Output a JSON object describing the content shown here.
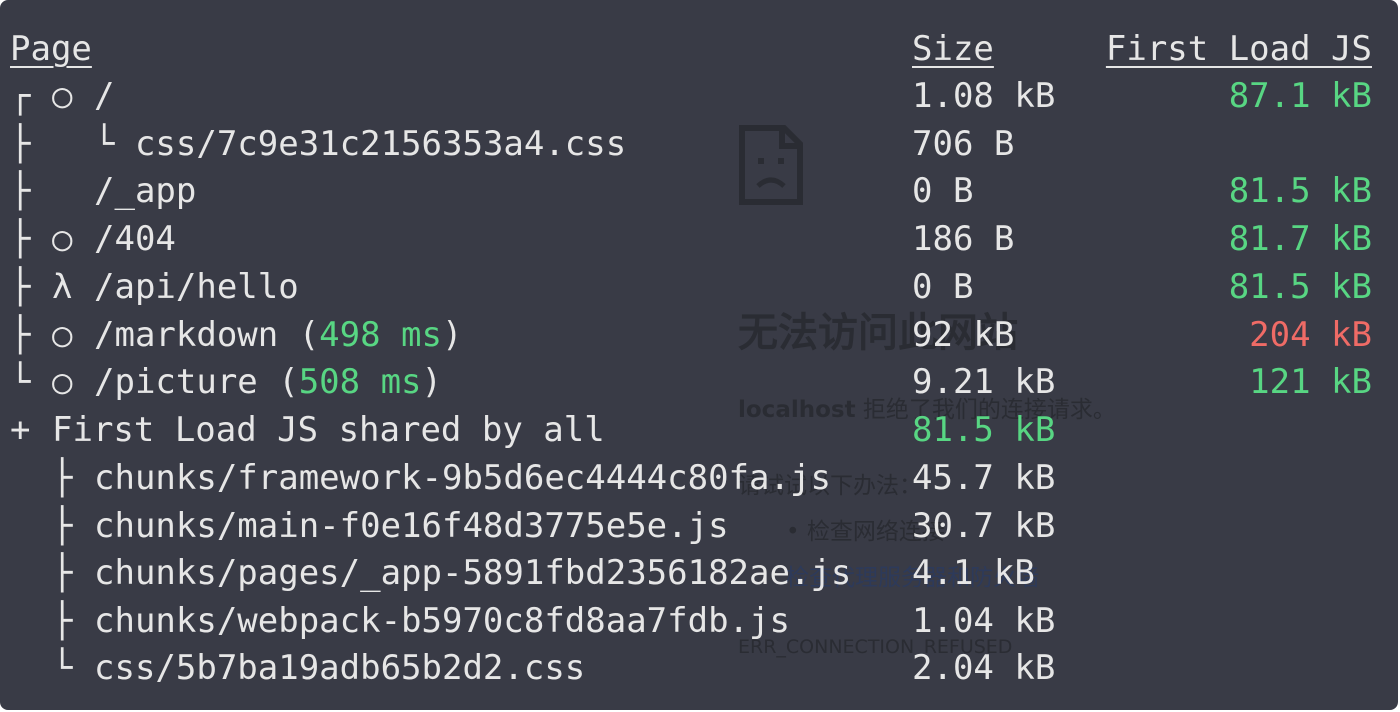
{
  "header": {
    "page": "Page",
    "size": "Size",
    "first_load": "First Load JS"
  },
  "rows": [
    {
      "tree": "┌",
      "sym": "○",
      "path": "/",
      "size": "1.08 kB",
      "first": "87.1 kB",
      "first_color": "#58d683"
    },
    {
      "tree": "├",
      "sym": "",
      "path": "└ css/7c9e31c2156353a4.css",
      "size": "706 B",
      "first": "",
      "first_color": "#58d683"
    },
    {
      "tree": "├",
      "sym": "",
      "path": "/_app",
      "size": "0 B",
      "first": "81.5 kB",
      "first_color": "#58d683"
    },
    {
      "tree": "├",
      "sym": "○",
      "path": "/404",
      "size": "186 B",
      "first": "81.7 kB",
      "first_color": "#58d683"
    },
    {
      "tree": "├",
      "sym": "λ",
      "path": "/api/hello",
      "size": "0 B",
      "first": "81.5 kB",
      "first_color": "#58d683"
    },
    {
      "tree": "├",
      "sym": "○",
      "path": "/markdown (",
      "ms": "498 ms",
      "path_end": ")",
      "size": "92 kB",
      "first": "204 kB",
      "first_color": "#ef6b66"
    },
    {
      "tree": "└",
      "sym": "○",
      "path": "/picture (",
      "ms": "508 ms",
      "path_end": ")",
      "size": "9.21 kB",
      "first": "121 kB",
      "first_color": "#58d683"
    }
  ],
  "shared": {
    "prefix": "+",
    "label": "First Load JS shared by all",
    "size": "81.5 kB"
  },
  "chunks": [
    {
      "tree": "├",
      "name": "chunks/framework-9b5d6ec4444c80fa.js",
      "size": "45.7 kB"
    },
    {
      "tree": "├",
      "name": "chunks/main-f0e16f48d3775e5e.js",
      "size": "30.7 kB"
    },
    {
      "tree": "├",
      "name": "chunks/pages/_app-5891fbd2356182ae.js",
      "size": "4.1 kB"
    },
    {
      "tree": "├",
      "name": "chunks/webpack-b5970c8fd8aa7fdb.js",
      "size": "1.04 kB"
    },
    {
      "tree": "└",
      "name": "css/5b7ba19adb65b2d2.css",
      "size": "2.04 kB"
    }
  ],
  "background_page": {
    "title": "无法访问此网站",
    "host": "localhost",
    "refused": "拒绝了我们的连接请求。",
    "try": "请试试以下办法：",
    "tip1": "检查网络连接",
    "tip2": "检查代理服务器和防火墙",
    "error_code": "ERR_CONNECTION_REFUSED"
  },
  "icon": "sad-page-icon"
}
